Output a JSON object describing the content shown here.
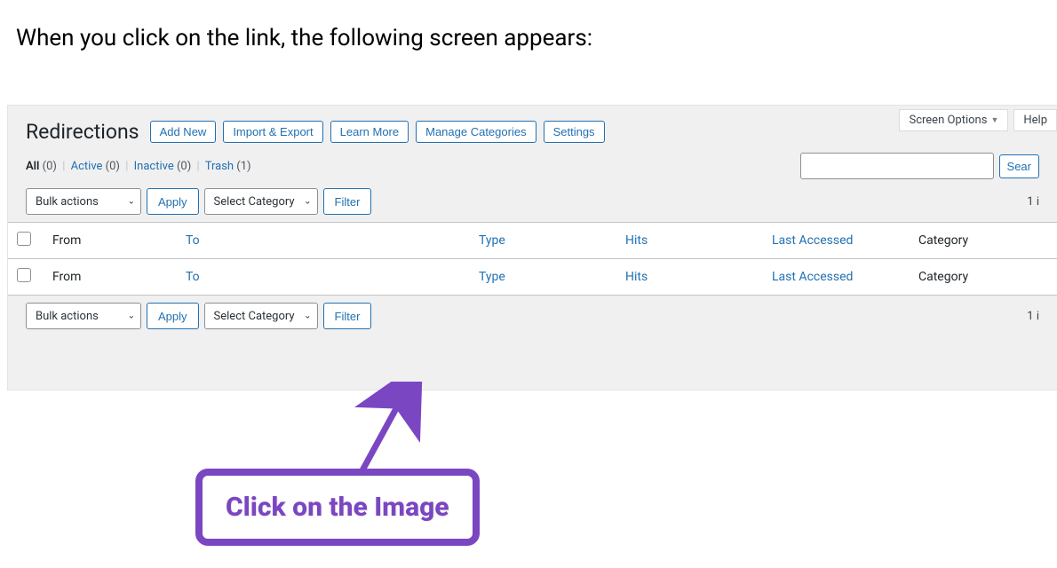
{
  "intro_text": "When you click on the link, the following screen appears:",
  "top_tabs": {
    "screen_options": "Screen Options",
    "help": "Help"
  },
  "page_title": "Redirections",
  "header_buttons": {
    "add_new": "Add New",
    "import_export": "Import & Export",
    "learn_more": "Learn More",
    "manage_categories": "Manage Categories",
    "settings": "Settings"
  },
  "status_filters": {
    "all_label": "All",
    "all_count": "(0)",
    "active_label": "Active",
    "active_count": "(0)",
    "inactive_label": "Inactive",
    "inactive_count": "(0)",
    "trash_label": "Trash",
    "trash_count": "(1)"
  },
  "search": {
    "button": "Sear"
  },
  "bulk": {
    "select_label": "Bulk actions",
    "apply": "Apply",
    "category_label": "Select Category",
    "filter": "Filter"
  },
  "item_count": "1 i",
  "columns": {
    "from": "From",
    "to": "To",
    "type": "Type",
    "hits": "Hits",
    "last_accessed": "Last Accessed",
    "category": "Category"
  },
  "callout": "Click on the Image"
}
